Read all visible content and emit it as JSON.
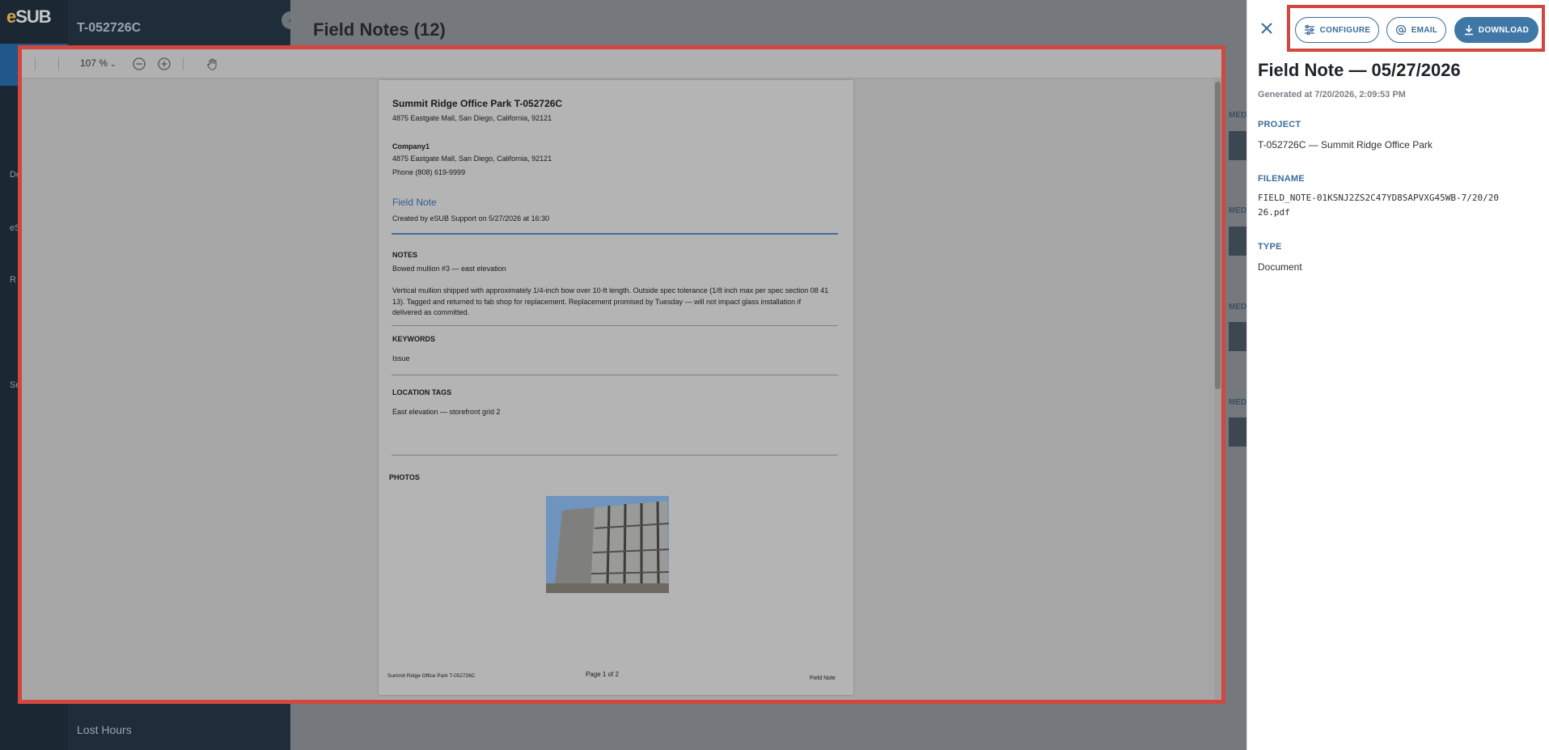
{
  "app": {
    "logo_prefix": "e",
    "logo_suffix": "SUB",
    "project_code": "T-052726C",
    "page_title": "Field Notes (12)",
    "sidebar_bottom_item": "Lost Hours",
    "rail_stubs": [
      "De",
      "eS",
      "R",
      "Se"
    ],
    "peek_labels": [
      "MED",
      "MED",
      "MED",
      "MED"
    ]
  },
  "viewer": {
    "zoom_label": "107 %",
    "icons": [
      "zoom-out-icon",
      "zoom-in-icon",
      "hand-tool-icon"
    ]
  },
  "pdf": {
    "project_heading": "Summit Ridge Office Park T-052726C",
    "project_address": "4875 Eastgate Mall, San Diego, California, 92121",
    "company_name": "Company1",
    "company_address": "4875 Eastgate Mall, San Diego, California, 92121",
    "company_phone": "Phone (808) 619-9999",
    "doc_type": "Field Note",
    "created_line": "Created by eSUB Support on 5/27/2026 at 16:30",
    "notes_header": "NOTES",
    "note_title": "Bowed mullion #3 — east elevation",
    "note_body": "Vertical mullion shipped with approximately 1/4-inch bow over 10-ft length. Outside spec tolerance (1/8 inch max per spec section 08 41 13). Tagged and returned to fab shop for replacement. Replacement promised by Tuesday — will not impact glass installation if delivered as committed.",
    "keywords_header": "KEYWORDS",
    "keyword": "Issue",
    "location_header": "LOCATION TAGS",
    "location": "East elevation — storefront grid 2",
    "photos_header": "PHOTOS",
    "footer_left": "Summit Ridge Office Park T-052726C",
    "footer_center": "Page 1 of 2",
    "footer_right": "Field Note"
  },
  "panel": {
    "configure_label": "CONFIGURE",
    "email_label": "EMAIL",
    "download_label": "DOWNLOAD",
    "title": "Field Note — 05/27/2026",
    "generated": "Generated at 7/20/2026, 2:09:53 PM",
    "project_label": "PROJECT",
    "project_value": "T-052726C — Summit Ridge Office Park",
    "filename_label": "FILENAME",
    "filename_value": "FIELD_NOTE-01KSNJ2ZS2C47YD8SAPVXG45WB-7/20/2026.pdf",
    "type_label": "TYPE",
    "type_value": "Document"
  },
  "colors": {
    "accent": "#3f77a6",
    "highlight": "#d2473f",
    "logo": "#d9a646"
  }
}
